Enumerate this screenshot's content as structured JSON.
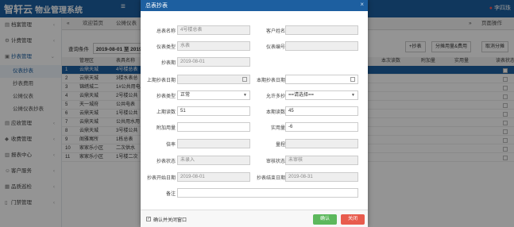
{
  "app": {
    "logo": "智轩云",
    "logo_sub": "物业管理系统",
    "menu_icon": "≡",
    "user": "李四珠"
  },
  "sidebar": {
    "items": [
      {
        "icon": "▤",
        "label": "档案管理"
      },
      {
        "icon": "⚙",
        "label": "计费管理"
      },
      {
        "icon": "▣",
        "label": "抄表管理"
      }
    ],
    "sub_items": [
      "仪表抄表",
      "抄表费用",
      "公摊仪表",
      "公摊仪表抄表"
    ],
    "items2": [
      {
        "icon": "▤",
        "label": "应收管理"
      },
      {
        "icon": "◆",
        "label": "收费管理"
      },
      {
        "icon": "▥",
        "label": "报表中心"
      },
      {
        "icon": "☺",
        "label": "客户服务"
      },
      {
        "icon": "▦",
        "label": "品质巡检"
      },
      {
        "icon": "▯",
        "label": "门禁管理"
      }
    ]
  },
  "tabs": {
    "back": "«",
    "home": "欢迎首页",
    "current": "公摊仪表",
    "forward": "»",
    "page_ops": "页面操作"
  },
  "query": {
    "label": "查询条件",
    "date_range": "2019-08-01 至 2019"
  },
  "toolbar": {
    "add": "+抄表",
    "share": "分摊用量&费用",
    "cancel_share": "取消分摊"
  },
  "grid": {
    "headers": [
      "管理区",
      "表具名称",
      "本次读数",
      "附加量",
      "实用量",
      "读表状态"
    ],
    "rows": [
      {
        "no": "1",
        "area": "云鼎天城",
        "name": "4号楼总表"
      },
      {
        "no": "2",
        "area": "云鼎天城",
        "name": "3楼水表总"
      },
      {
        "no": "3",
        "area": "锦绣城二",
        "name": "1#公共用电"
      },
      {
        "no": "4",
        "area": "云鼎天城",
        "name": "2号楼公共"
      },
      {
        "no": "5",
        "area": "天一城府",
        "name": "公共电表"
      },
      {
        "no": "6",
        "area": "云鼎天城",
        "name": "1号楼公共"
      },
      {
        "no": "7",
        "area": "云鼎天城",
        "name": "公共用水用"
      },
      {
        "no": "8",
        "area": "云鼎天城",
        "name": "3号楼公共"
      },
      {
        "no": "9",
        "area": "阁雅寓所",
        "name": "1栋总表"
      },
      {
        "no": "10",
        "area": "家家乐小区",
        "name": "二次供水"
      },
      {
        "no": "11",
        "area": "家家乐小区",
        "name": "1号楼二次"
      }
    ]
  },
  "dialog": {
    "title": "总表抄表",
    "close_icon": "×",
    "fields": {
      "meter_name": {
        "label": "总表名称",
        "value": "4号楼总表"
      },
      "customer_name": {
        "label": "客户姓名",
        "value": ""
      },
      "meter_type": {
        "label": "仪表类型",
        "value": "水表"
      },
      "meter_no": {
        "label": "仪表编号",
        "value": ""
      },
      "period": {
        "label": "抄表期",
        "value": "2019-08-01"
      },
      "last_date": {
        "label": "上期抄表日期",
        "value": ""
      },
      "this_date": {
        "label": "本期抄表日期",
        "value": ""
      },
      "read_type": {
        "label": "抄表类型",
        "value": "正常"
      },
      "allow_multi": {
        "label": "允许多抄",
        "value": "==请选择=="
      },
      "last_reading": {
        "label": "上期读数",
        "value": "51"
      },
      "this_reading": {
        "label": "本期读数",
        "value": "45"
      },
      "extra": {
        "label": "附加用量",
        "value": ""
      },
      "actual": {
        "label": "实用量",
        "value": "-6"
      },
      "multiplier": {
        "label": "倍率",
        "value": ""
      },
      "range": {
        "label": "量程",
        "value": ""
      },
      "read_status": {
        "label": "抄表状态",
        "value": "未录入"
      },
      "audit_status": {
        "label": "审核状态",
        "value": "未审核"
      },
      "start_date": {
        "label": "抄表开始日期",
        "value": "2019-08-01"
      },
      "end_date": {
        "label": "抄表结束日期",
        "value": "2019-08-31"
      },
      "note": {
        "label": "备注",
        "value": ""
      }
    },
    "footer": {
      "checkbox_label": "确认并关闭窗口",
      "ok": "确认",
      "close": "关闭"
    }
  },
  "colors": {
    "primary": "#1d5fa0",
    "ok": "#5cb85c",
    "danger": "#e85b4d"
  }
}
